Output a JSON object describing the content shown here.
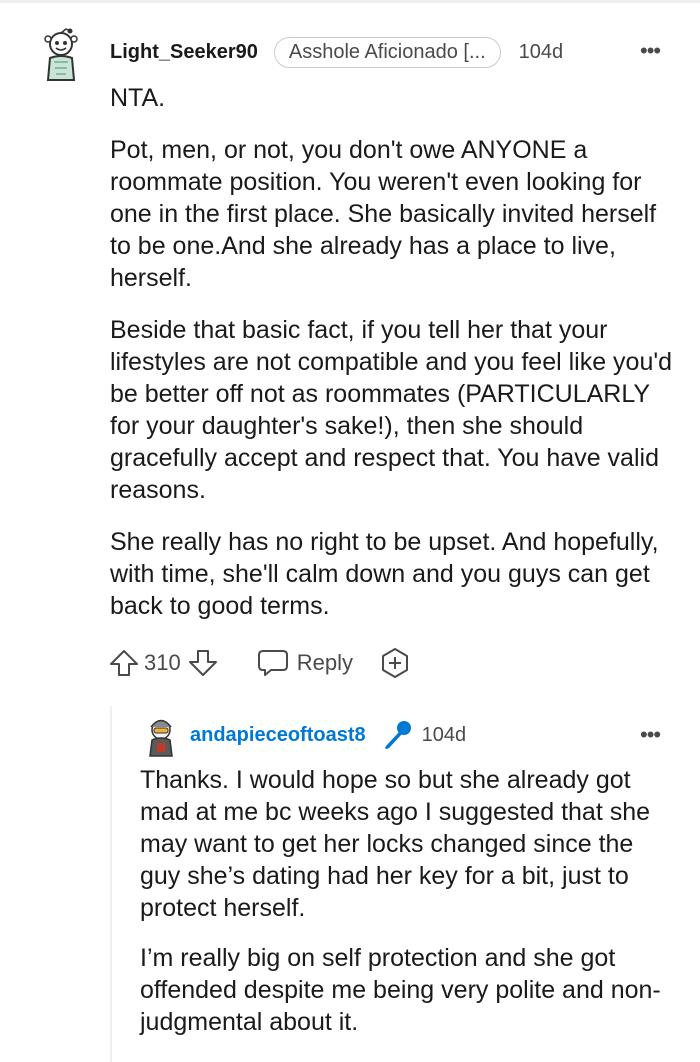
{
  "comment": {
    "username": "Light_Seeker90",
    "flair": "Asshole Aficionado [...",
    "age": "104d",
    "paragraphs": [
      "NTA.",
      "Pot, men, or not, you don't owe ANYONE a roommate position. You weren't even looking for one in the first place. She basically invited herself to be one.And she already has a place to live, herself.",
      "Beside that basic fact, if you tell her that your lifestyles are not compatible and you feel like you'd be better off not as roommates (PARTICULARLY for your daughter's sake!), then she should gracefully accept and respect that. You have valid reasons.",
      "She really has no right to be upset. And hopefully, with time, she'll calm down and you guys can get back to good terms."
    ],
    "votes": "310",
    "reply_label": "Reply"
  },
  "reply": {
    "username": "andapieceoftoast8",
    "age": "104d",
    "paragraphs": [
      "Thanks. I would hope so but she already got mad at me bc weeks ago I suggested that she may want to get her locks changed since the guy she’s dating had her key for a bit, just to protect herself.",
      "I’m really big on self protection and she got offended despite me being very polite and non-judgmental about it."
    ]
  },
  "icons": {
    "upvote": "upvote-arrow-icon",
    "downvote": "downvote-arrow-icon",
    "reply": "speech-bubble-icon",
    "award": "award-plus-icon",
    "more": "more-dots-icon",
    "mic": "microphone-icon"
  },
  "colors": {
    "accent_blue": "#0079d3",
    "text": "#1a1a1b",
    "muted": "#4a4a4a"
  }
}
